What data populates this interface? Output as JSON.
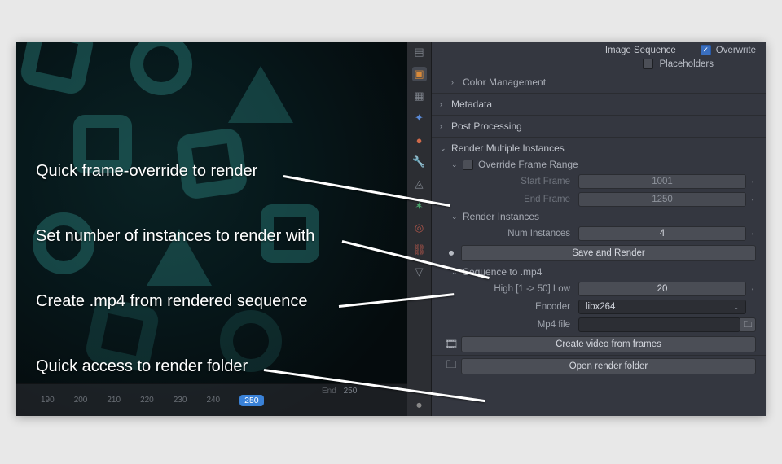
{
  "top": {
    "image_sequence_label": "Image Sequence",
    "overwrite_label": "Overwrite",
    "overwrite_checked": true,
    "placeholders_label": "Placeholders",
    "placeholders_checked": false
  },
  "sections": {
    "color_mgmt": "Color Management",
    "metadata": "Metadata",
    "post_processing": "Post Processing",
    "render_multi": "Render Multiple Instances",
    "override_range": "Override Frame Range",
    "render_instances": "Render Instances",
    "sequence_mp4": "Sequence to .mp4"
  },
  "frame": {
    "start_label": "Start Frame",
    "start_value": "1001",
    "end_label": "End Frame",
    "end_value": "1250"
  },
  "instances": {
    "num_label": "Num Instances",
    "num_value": "4",
    "save_render_btn": "Save and Render"
  },
  "seq": {
    "quality_label": "High [1 -> 50] Low",
    "quality_value": "20",
    "encoder_label": "Encoder",
    "encoder_value": "libx264",
    "mp4file_label": "Mp4 file",
    "create_btn": "Create video from frames"
  },
  "footer": {
    "open_folder_btn": "Open render folder"
  },
  "timeline": {
    "end_label": "End",
    "end_value": "250",
    "ticks": [
      "190",
      "200",
      "210",
      "220",
      "230",
      "240"
    ],
    "current": "250"
  },
  "annotations": {
    "a1": "Quick frame-override to render",
    "a2": "Set number of instances to render with",
    "a3": "Create .mp4 from rendered sequence",
    "a4": "Quick access to render folder"
  },
  "icons": {
    "render": "▣",
    "output": "▴",
    "view": "✦",
    "scene": "⚙",
    "world": "🌐",
    "obj": "◳",
    "mod": "🔧",
    "particles": "✶",
    "physics": "⦿",
    "constraints": "⛓",
    "camera": "⏺",
    "film": "🎞",
    "folder": "📁",
    "chev_r": "›",
    "chev_d": "⌄",
    "file": "🗀"
  }
}
